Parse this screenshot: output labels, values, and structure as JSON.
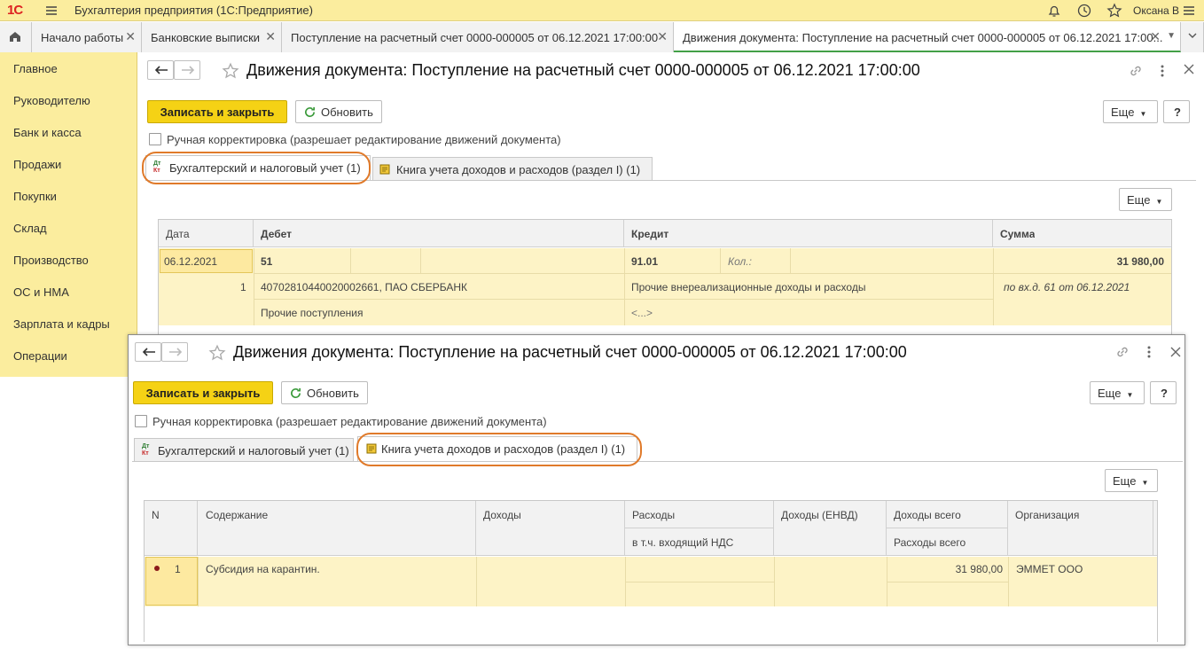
{
  "app": {
    "logo": "1С",
    "title": "Бухгалтерия предприятия  (1С:Предприятие)",
    "user": "Оксана В"
  },
  "tabs": [
    {
      "label": "Начало работы"
    },
    {
      "label": "Банковские выписки"
    },
    {
      "label": "Поступление на расчетный счет 0000-000005 от 06.12.2021 17:00:00"
    },
    {
      "label": "Движения документа: Поступление на расчетный счет 0000-000005 от 06.12.2021 17:00..."
    }
  ],
  "sidebar": {
    "items": [
      "Главное",
      "Руководителю",
      "Банк и касса",
      "Продажи",
      "Покупки",
      "Склад",
      "Производство",
      "ОС и НМА",
      "Зарплата и кадры",
      "Операции"
    ]
  },
  "form": {
    "title": "Движения документа: Поступление на расчетный счет 0000-000005 от 06.12.2021 17:00:00",
    "save_close": "Записать и закрыть",
    "refresh": "Обновить",
    "more": "Еще",
    "help": "?",
    "manual_label": "Ручная корректировка (разрешает редактирование движений документа)",
    "tab_acc": "Бухгалтерский и налоговый учет (1)",
    "tab_book": "Книга учета доходов и расходов (раздел I) (1)",
    "tab_acc_icon": "Дт Кт"
  },
  "acc_table": {
    "headers": {
      "date": "Дата",
      "debit": "Дебет",
      "credit": "Кредит",
      "sum": "Сумма"
    },
    "row": {
      "date": "06.12.2021",
      "num": "1",
      "debit_acc": "51",
      "debit_sub1": "40702810440020002661, ПАО СБЕРБАНК",
      "debit_sub2": "Прочие поступления",
      "credit_acc": "91.01",
      "credit_qty": "Кол.:",
      "credit_sub1": "Прочие внереализационные доходы и расходы",
      "credit_sub2": "<...>",
      "sum": "31 980,00",
      "sum_note": "по вх.д. 61 от 06.12.2021"
    }
  },
  "book_table": {
    "headers": {
      "n": "N",
      "content": "Содержание",
      "income": "Доходы",
      "expenses": "Расходы",
      "vat": "в т.ч. входящий НДС",
      "income_envd": "Доходы (ЕНВД)",
      "income_total": "Доходы всего",
      "expenses_total": "Расходы всего",
      "org": "Организация"
    },
    "row": {
      "n": "1",
      "content": "Субсидия на карантин.",
      "income_total": "31 980,00",
      "org": "ЭММЕТ ООО"
    }
  },
  "colors": {
    "yellow": "#f5d215",
    "orange_oval": "#e07a2a",
    "row_bg": "#fdf3c6",
    "title_bg": "#fbed9e"
  }
}
